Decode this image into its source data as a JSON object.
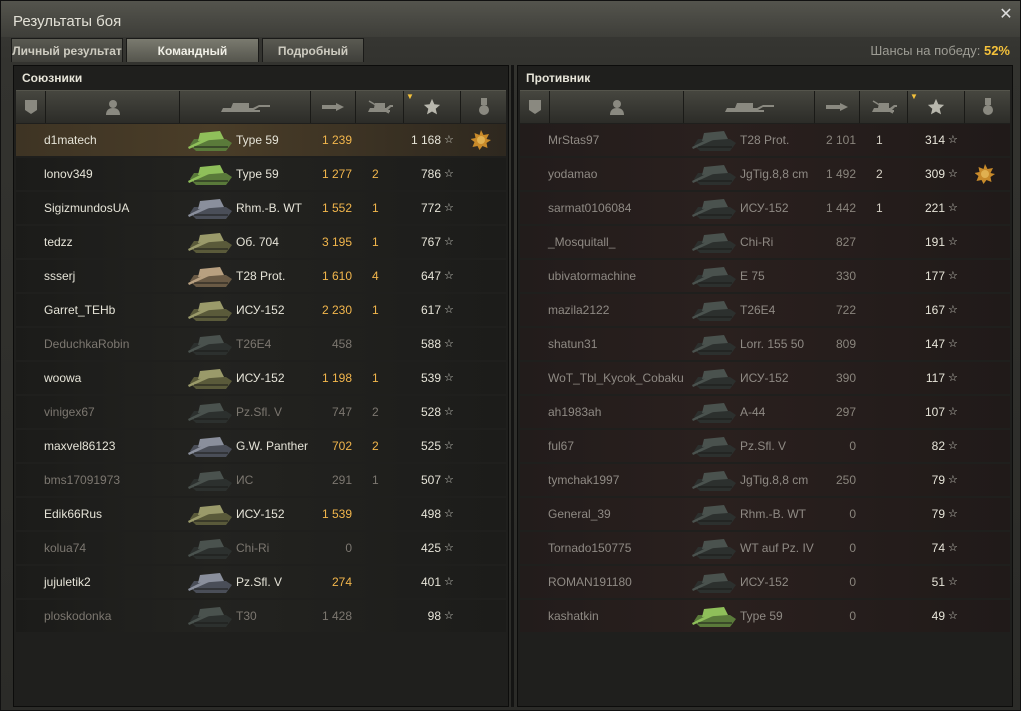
{
  "window": {
    "title": "Результаты боя"
  },
  "tabs": [
    {
      "label": "Личный результат",
      "active": false
    },
    {
      "label": "Командный результат",
      "active": true
    },
    {
      "label": "Подробный отчёт",
      "active": false
    }
  ],
  "win_chance": {
    "label": "Шансы на победу:",
    "value": "52%"
  },
  "columns": [
    "rank-icon",
    "player-icon",
    "tank-icon",
    "damage-icon",
    "kills-icon",
    "xp-star-icon",
    "medal-icon"
  ],
  "allies": {
    "label": "Союзники",
    "rows": [
      {
        "player": "d1matech",
        "vehicle": "Type 59",
        "damage": "1 239",
        "kills": "",
        "xp": "1 168",
        "alive": true,
        "highlight": true,
        "medal": true,
        "tank_color": "green"
      },
      {
        "player": "lonov349",
        "vehicle": "Type 59",
        "damage": "1 277",
        "kills": "2",
        "xp": "786",
        "alive": true,
        "tank_color": "green"
      },
      {
        "player": "SigizmundosUA",
        "vehicle": "Rhm.-B. WT",
        "damage": "1 552",
        "kills": "1",
        "xp": "772",
        "alive": true,
        "tank_color": "grey"
      },
      {
        "player": "tedzz",
        "vehicle": "Об. 704",
        "damage": "3 195",
        "kills": "1",
        "xp": "767",
        "alive": true,
        "tank_color": "olive"
      },
      {
        "player": "ssserj",
        "vehicle": "T28 Prot.",
        "damage": "1 610",
        "kills": "4",
        "xp": "647",
        "alive": true,
        "tank_color": "tan"
      },
      {
        "player": "Garret_TEHb",
        "vehicle": "ИСУ-152",
        "damage": "2 230",
        "kills": "1",
        "xp": "617",
        "alive": true,
        "tank_color": "olive"
      },
      {
        "player": "DeduchkaRobin",
        "vehicle": "T26E4",
        "damage": "458",
        "kills": "",
        "xp": "588",
        "alive": false,
        "tank_color": "dark"
      },
      {
        "player": "woowa",
        "vehicle": "ИСУ-152",
        "damage": "1 198",
        "kills": "1",
        "xp": "539",
        "alive": true,
        "tank_color": "olive"
      },
      {
        "player": "vinigex67",
        "vehicle": "Pz.Sfl. V",
        "damage": "747",
        "kills": "2",
        "xp": "528",
        "alive": false,
        "tank_color": "dark"
      },
      {
        "player": "maxvel86123",
        "vehicle": "G.W. Panther",
        "damage": "702",
        "kills": "2",
        "xp": "525",
        "alive": true,
        "tank_color": "grey"
      },
      {
        "player": "bms17091973",
        "vehicle": "ИС",
        "damage": "291",
        "kills": "1",
        "xp": "507",
        "alive": false,
        "tank_color": "dark"
      },
      {
        "player": "Edik66Rus",
        "vehicle": "ИСУ-152",
        "damage": "1 539",
        "kills": "",
        "xp": "498",
        "alive": true,
        "tank_color": "olive"
      },
      {
        "player": "kolua74",
        "vehicle": "Chi-Ri",
        "damage": "0",
        "kills": "",
        "xp": "425",
        "alive": false,
        "tank_color": "dark"
      },
      {
        "player": "jujuletik2",
        "vehicle": "Pz.Sfl. V",
        "damage": "274",
        "kills": "",
        "xp": "401",
        "alive": true,
        "tank_color": "grey"
      },
      {
        "player": "ploskodonka",
        "vehicle": "T30",
        "damage": "1 428",
        "kills": "",
        "xp": "98",
        "alive": false,
        "tank_color": "dark"
      }
    ]
  },
  "enemies": {
    "label": "Противник",
    "rows": [
      {
        "player": "MrStas97",
        "vehicle": "T28 Prot.",
        "damage": "2 101",
        "kills": "1",
        "xp": "314",
        "tank_color": "dark"
      },
      {
        "player": "yodamao",
        "vehicle": "JgTig.8,8 cm",
        "damage": "1 492",
        "kills": "2",
        "xp": "309",
        "medal": true,
        "tank_color": "dark"
      },
      {
        "player": "sarmat0106084",
        "vehicle": "ИСУ-152",
        "damage": "1 442",
        "kills": "1",
        "xp": "221",
        "tank_color": "dark"
      },
      {
        "player": "_Mosquitall_",
        "vehicle": "Chi-Ri",
        "damage": "827",
        "kills": "",
        "xp": "191",
        "tank_color": "dark"
      },
      {
        "player": "ubivatormachine",
        "vehicle": "E 75",
        "damage": "330",
        "kills": "",
        "xp": "177",
        "tank_color": "dark"
      },
      {
        "player": "mazila2122",
        "vehicle": "T26E4",
        "damage": "722",
        "kills": "",
        "xp": "167",
        "tank_color": "dark"
      },
      {
        "player": "shatun31",
        "vehicle": "Lorr. 155 50",
        "damage": "809",
        "kills": "",
        "xp": "147",
        "tank_color": "dark"
      },
      {
        "player": "WoT_Tbl_Kycok_Cobaku",
        "vehicle": "ИСУ-152",
        "damage": "390",
        "kills": "",
        "xp": "117",
        "tank_color": "dark"
      },
      {
        "player": "ah1983ah",
        "vehicle": "A-44",
        "damage": "297",
        "kills": "",
        "xp": "107",
        "tank_color": "dark"
      },
      {
        "player": "ful67",
        "vehicle": "Pz.Sfl. V",
        "damage": "0",
        "kills": "",
        "xp": "82",
        "tank_color": "dark"
      },
      {
        "player": "tymchak1997",
        "vehicle": "JgTig.8,8 cm",
        "damage": "250",
        "kills": "",
        "xp": "79",
        "tank_color": "dark"
      },
      {
        "player": "General_39",
        "vehicle": "Rhm.-B. WT",
        "damage": "0",
        "kills": "",
        "xp": "79",
        "tank_color": "dark"
      },
      {
        "player": "Tornado150775",
        "vehicle": "WT auf Pz. IV",
        "damage": "0",
        "kills": "",
        "xp": "74",
        "tank_color": "dark"
      },
      {
        "player": "ROMAN191180",
        "vehicle": "ИСУ-152",
        "damage": "0",
        "kills": "",
        "xp": "51",
        "tank_color": "dark"
      },
      {
        "player": "kashatkin",
        "vehicle": "Type 59",
        "damage": "0",
        "kills": "",
        "xp": "49",
        "tank_color": "green"
      }
    ]
  },
  "star_glyph": "☆"
}
